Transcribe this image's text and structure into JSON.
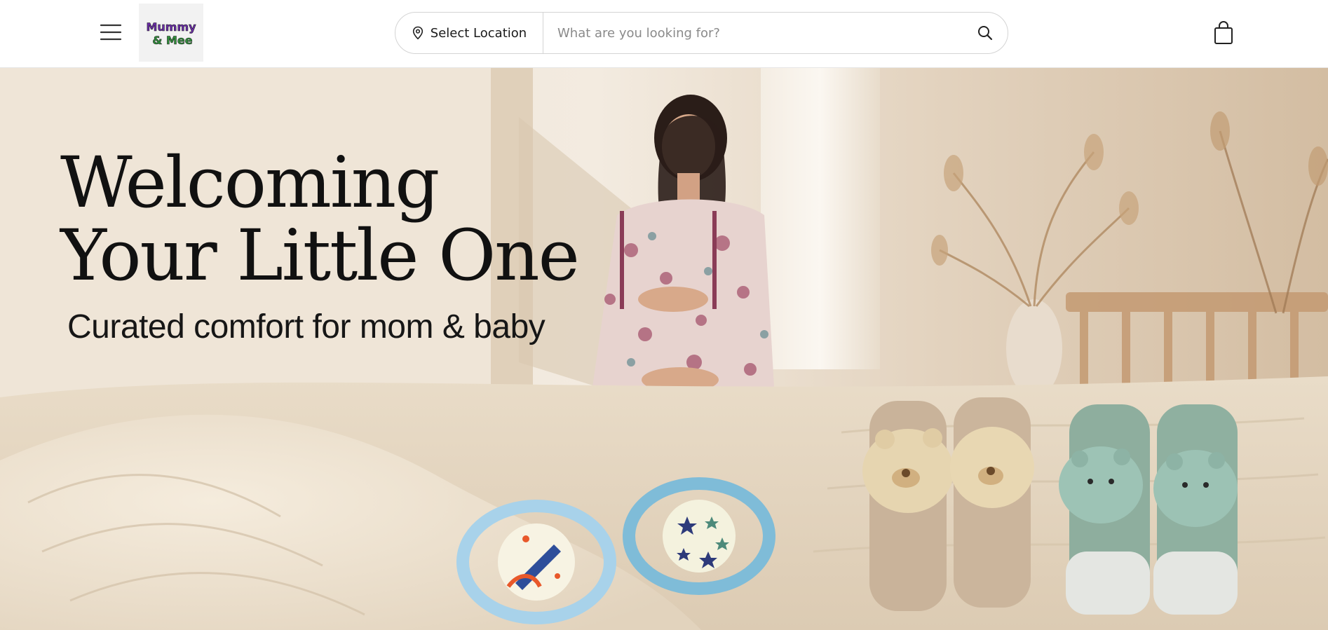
{
  "header": {
    "brand_logo_text_line1": "Mummy",
    "brand_logo_text_line2": "& Mee",
    "location_label": "Select Location",
    "search_placeholder": "What are you looking for?"
  },
  "icons": {
    "menu": "hamburger-menu-icon",
    "location": "map-pin-icon",
    "search": "magnifier-icon",
    "cart": "shopping-bag-icon"
  },
  "hero": {
    "title_line1": "Welcoming",
    "title_line2": "Your Little One",
    "subtitle": "Curated comfort for mom & baby"
  },
  "colors": {
    "text_dark": "#111111",
    "hero_bg_light": "#efe3d3",
    "hero_bg_dark": "#d8c3a8",
    "pacifier_blue": "#8fc3dc",
    "sock_green": "#8fb0a0",
    "sock_beige": "#c7b29b"
  }
}
